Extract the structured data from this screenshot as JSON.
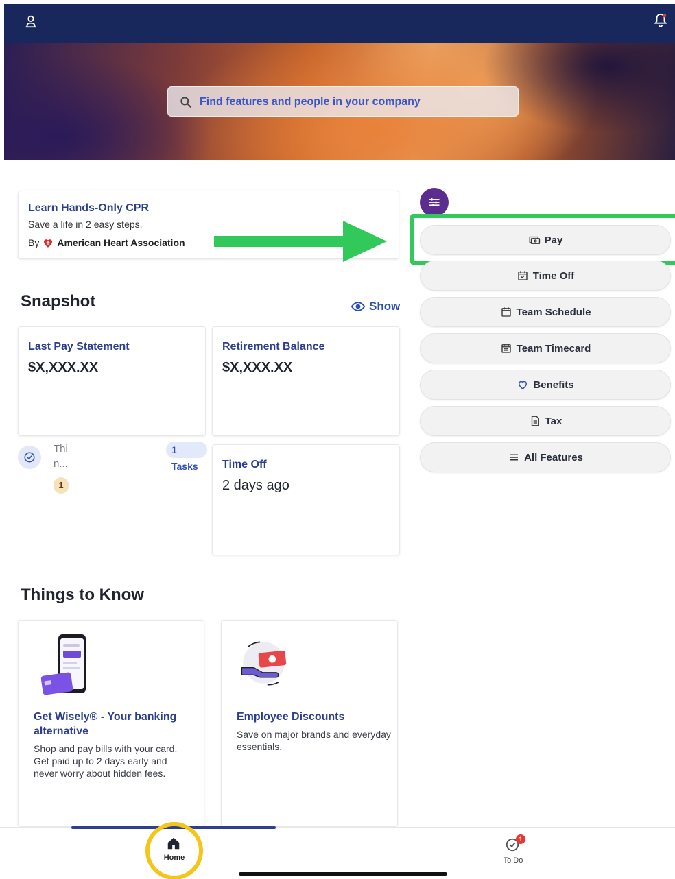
{
  "search": {
    "placeholder": "Find features and people in your company"
  },
  "cpr_card": {
    "title": "Learn Hands-Only CPR",
    "subtitle": "Save a life in 2 easy steps.",
    "by_label": "By",
    "organization": "American Heart Association"
  },
  "features": [
    {
      "label": "Pay",
      "icon": "pay-icon"
    },
    {
      "label": "Time Off",
      "icon": "calendar-check-icon"
    },
    {
      "label": "Team Schedule",
      "icon": "calendar-icon"
    },
    {
      "label": "Team Timecard",
      "icon": "calendar-list-icon"
    },
    {
      "label": "Benefits",
      "icon": "heart-icon"
    },
    {
      "label": "Tax",
      "icon": "document-icon"
    },
    {
      "label": "All Features",
      "icon": "menu-icon"
    }
  ],
  "snapshot": {
    "title": "Snapshot",
    "show_label": "Show",
    "cards": [
      {
        "label": "Last Pay Statement",
        "value": "$X,XXX.XX"
      },
      {
        "label": "Retirement Balance",
        "value": "$X,XXX.XX"
      },
      {
        "label": "Time Off",
        "value": "2 days ago"
      }
    ],
    "task": {
      "line1": "Thi",
      "line2": "n...",
      "tasks_badge": "1 Tasks",
      "count": "1"
    }
  },
  "things_to_know": {
    "title": "Things to Know",
    "cards": [
      {
        "title": "Get Wisely® - Your banking alternative",
        "description": "Shop and pay bills with your card. Get paid up to 2 days early and never worry about hidden fees."
      },
      {
        "title": "Employee Discounts",
        "description": "Save on major brands and everyday essentials."
      }
    ]
  },
  "bottom_nav": {
    "home_label": "Home",
    "todo_label": "To Do",
    "todo_badge": "1"
  },
  "colors": {
    "topbar": "#19285c",
    "accent_link": "#2c3f8e",
    "highlight_green": "#30c95a",
    "highlight_yellow": "#f4c51a",
    "filter_button": "#5b2d8f"
  }
}
